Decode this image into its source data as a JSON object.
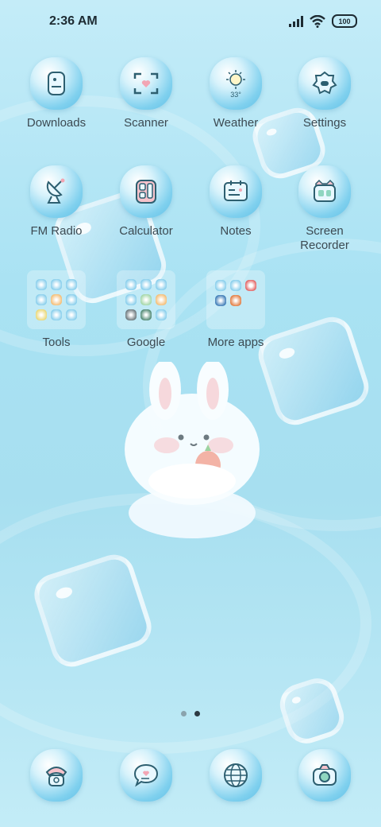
{
  "status_bar": {
    "time": "2:36 AM",
    "battery": "100"
  },
  "home": {
    "row1": [
      {
        "label": "Downloads",
        "icon": "downloads-icon"
      },
      {
        "label": "Scanner",
        "icon": "scanner-icon"
      },
      {
        "label": "Weather",
        "icon": "weather-icon",
        "temp": "33°"
      },
      {
        "label": "Settings",
        "icon": "settings-icon"
      }
    ],
    "row2": [
      {
        "label": "FM Radio",
        "icon": "radio-icon"
      },
      {
        "label": "Calculator",
        "icon": "calculator-icon"
      },
      {
        "label": "Notes",
        "icon": "notes-icon"
      },
      {
        "label": "Screen\nRecorder",
        "icon": "screen-recorder-icon"
      }
    ],
    "folders": [
      {
        "label": "Tools",
        "count": 9
      },
      {
        "label": "Google",
        "count": 9
      },
      {
        "label": "More apps",
        "count": 5
      }
    ]
  },
  "page_indicator": {
    "pages": 2,
    "current": 2
  },
  "dock": [
    {
      "icon": "phone-icon"
    },
    {
      "icon": "messages-icon"
    },
    {
      "icon": "browser-icon"
    },
    {
      "icon": "camera-icon"
    }
  ],
  "colors": {
    "accent": "#5fbfe6",
    "text": "#3c4a52",
    "status_text": "#1d2b33"
  }
}
